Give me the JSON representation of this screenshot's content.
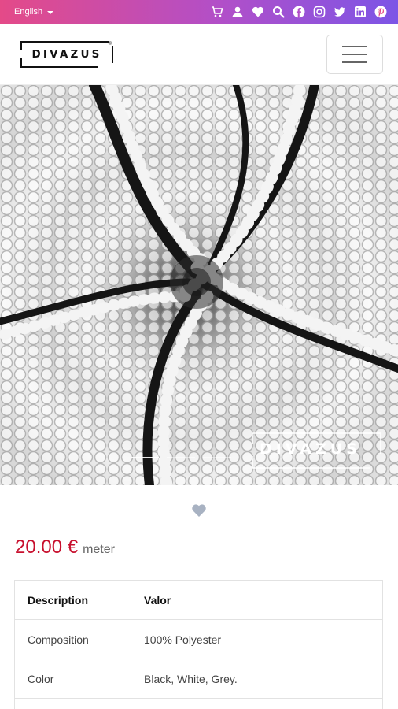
{
  "topbar": {
    "language": "English",
    "icons": [
      "cart-icon",
      "user-icon",
      "heart-icon",
      "search-icon",
      "facebook-icon",
      "instagram-icon",
      "twitter-icon",
      "linkedin-icon",
      "pinterest-icon"
    ],
    "colors": {
      "gradient_start": "#e44a88",
      "gradient_end": "#7c55e6"
    }
  },
  "header": {
    "logo_text": "DIVAZUS",
    "logo_mark": "®",
    "menu_icon": "hamburger-icon"
  },
  "hero": {
    "watermark": "DIVAZUS",
    "slides_count": 3,
    "active_slide": 1
  },
  "product": {
    "favorite_icon": "heart-icon",
    "price": "20.00 €",
    "unit": "meter",
    "price_color": "#c8102e"
  },
  "spec_table": {
    "headers": [
      "Description",
      "Valor"
    ],
    "rows": [
      [
        "Composition",
        "100% Polyester"
      ],
      [
        "Color",
        "Black, White, Grey."
      ]
    ]
  }
}
